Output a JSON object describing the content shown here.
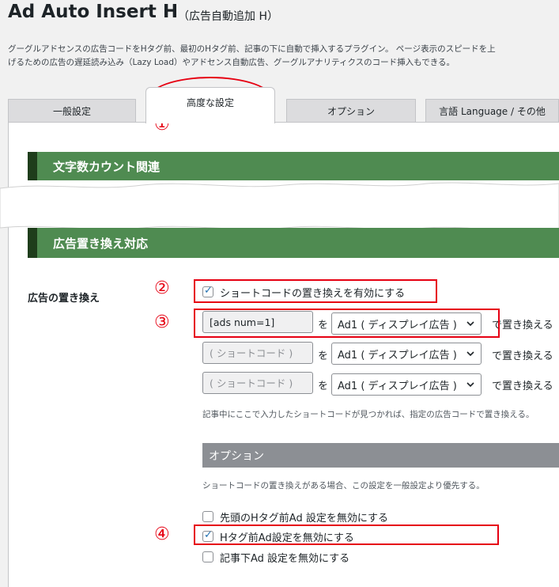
{
  "header": {
    "title": "Ad Auto Insert H",
    "subtitle": "（広告自動追加 H）",
    "description_line1": "グーグルアドセンスの広告コードをHタグ前、最初のHタグ前、記事の下に自動で挿入するプラグイン。 ページ表示のスピードを上",
    "description_line2": "げるための広告の遅延読み込み（Lazy Load）やアドセンス自動広告、グーグルアナリティクスのコード挿入もできる。"
  },
  "tabs": [
    {
      "label": "一般設定",
      "active": false
    },
    {
      "label": "高度な設定",
      "active": true
    },
    {
      "label": "オプション",
      "active": false
    },
    {
      "label": "言語 Language / その他",
      "active": false
    }
  ],
  "sections": {
    "char_count_title": "文字数カウント関連",
    "ad_replace_title": "広告置き換え対応"
  },
  "ad_replace": {
    "label": "広告の置き換え",
    "enable_checkbox_label": "ショートコードの置き換えを有効にする",
    "enable_checked": true,
    "rows": [
      {
        "value": "[ads num=1]",
        "placeholder": "",
        "wo": "を",
        "select": "Ad1 ( ディスプレイ広告 )",
        "suffix": "で置き換える"
      },
      {
        "value": "",
        "placeholder": "( ショートコード )",
        "wo": "を",
        "select": "Ad1 ( ディスプレイ広告 )",
        "suffix": "で置き換える"
      },
      {
        "value": "",
        "placeholder": "( ショートコード )",
        "wo": "を",
        "select": "Ad1 ( ディスプレイ広告 )",
        "suffix": "で置き換える"
      }
    ],
    "note": "記事中にここで入力したショートコードが見つかれば、指定の広告コードで置き換える。",
    "options_title": "オプション",
    "options_note": "ショートコードの置き換えがある場合、この設定を一般設定より優先する。",
    "options": [
      {
        "label": "先頭のHタグ前Ad 設定を無効にする",
        "checked": false
      },
      {
        "label": "Hタグ前Ad設定を無効にする",
        "checked": true
      },
      {
        "label": "記事下Ad 設定を無効にする",
        "checked": false
      }
    ]
  },
  "annotations": [
    "①",
    "②",
    "③",
    "④"
  ],
  "colors": {
    "section_green": "#4f8b51",
    "section_border": "#1e3d1b",
    "annotation_red": "#e60012",
    "option_bar": "#8c8f94"
  }
}
